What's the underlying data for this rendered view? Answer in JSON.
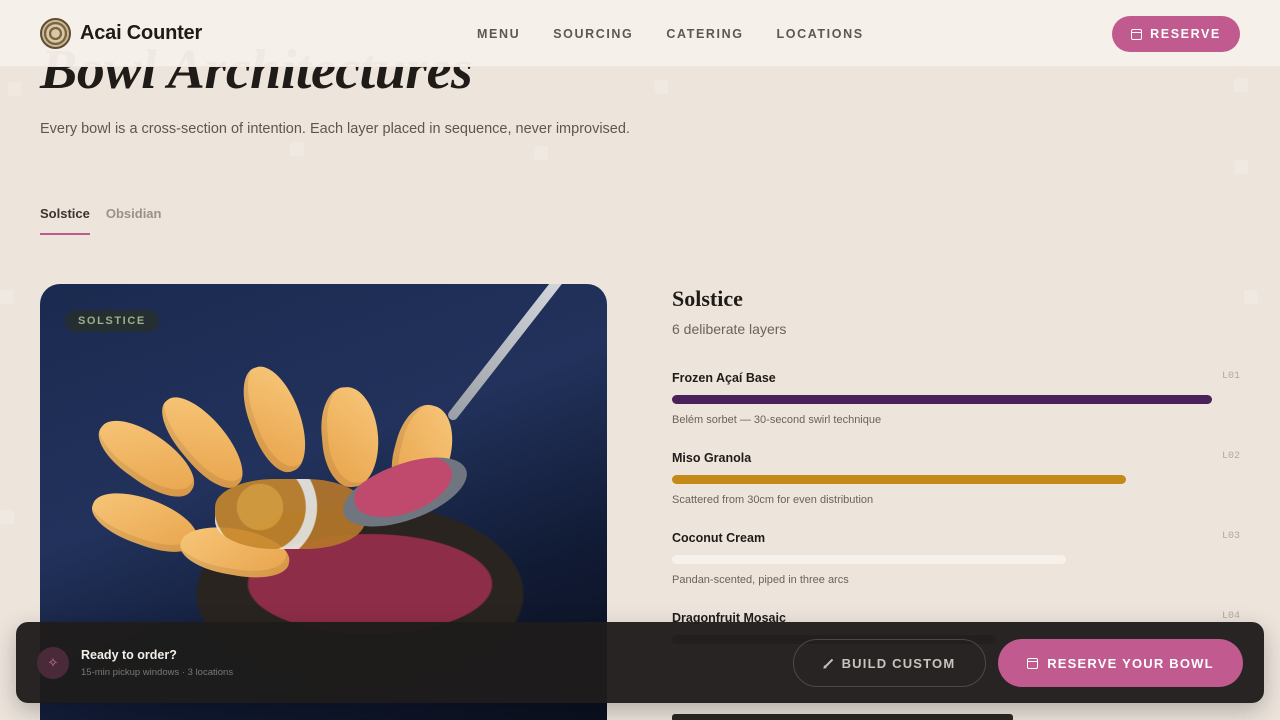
{
  "header": {
    "brand_name": "Acai Counter",
    "logo_icon": "acai-spiral-logo",
    "nav": [
      "MENU",
      "SOURCING",
      "CATERING",
      "LOCATIONS"
    ],
    "reserve_label": "RESERVE"
  },
  "hero": {
    "title": "Bowl Architectures",
    "subtitle": "Every bowl is a cross-section of intention. Each layer placed in sequence, never improvised."
  },
  "tabs": [
    {
      "label": "Solstice",
      "active": true
    },
    {
      "label": "Obsidian",
      "active": false
    }
  ],
  "card": {
    "badge": "SOLSTICE"
  },
  "detail": {
    "title": "Solstice",
    "subtitle": "6 deliberate layers",
    "layers": [
      {
        "name": "Frozen Açaí Base",
        "code": "L01",
        "desc": "Belém sorbet — 30-second swirl technique",
        "fill": 1.0,
        "color": "#4b2159"
      },
      {
        "name": "Miso Granola",
        "code": "L02",
        "desc": "Scattered from 30cm for even distribution",
        "fill": 0.84,
        "color": "#c38a1a"
      },
      {
        "name": "Coconut Cream",
        "code": "L03",
        "desc": "Pandan-scented, piped in three arcs",
        "fill": 0.73,
        "color": "#f6f1ea"
      },
      {
        "name": "Dragonfruit Mosaic",
        "code": "L04",
        "desc": "",
        "fill": 0.6,
        "color": "#c15a8f"
      }
    ]
  },
  "cta": {
    "icon": "sparkle-icon",
    "title": "Ready to order?",
    "meta": "15-min pickup windows · 3 locations",
    "build_label": "BUILD CUSTOM",
    "reserve_label": "RESERVE YOUR BOWL"
  },
  "colors": {
    "accent": "#c15a8f",
    "background": "#ede5dc",
    "dark_bar": "#1e1c1b"
  }
}
